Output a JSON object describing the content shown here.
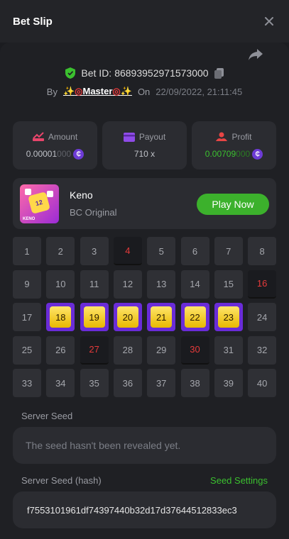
{
  "header": {
    "title": "Bet Slip"
  },
  "bet": {
    "id_label": "Bet ID:",
    "id": "86893952971573000",
    "by_label": "By",
    "user": "Master",
    "on_label": "On",
    "date": "22/09/2022, 21:11:45"
  },
  "stats": {
    "amount": {
      "label": "Amount",
      "value_main": "0.00001",
      "value_dim": "000"
    },
    "payout": {
      "label": "Payout",
      "value": "710 x"
    },
    "profit": {
      "label": "Profit",
      "value_main": "0.00709",
      "value_dim": "000"
    },
    "coin_symbol": "₵"
  },
  "game": {
    "name": "Keno",
    "subtitle": "BC Original",
    "thumb_label": "KENO",
    "play_label": "Play Now"
  },
  "board": {
    "numbers": [
      1,
      2,
      3,
      4,
      5,
      6,
      7,
      8,
      9,
      10,
      11,
      12,
      13,
      14,
      15,
      16,
      17,
      18,
      19,
      20,
      21,
      22,
      23,
      24,
      25,
      26,
      27,
      28,
      29,
      30,
      31,
      32,
      33,
      34,
      35,
      36,
      37,
      38,
      39,
      40
    ],
    "hits": [
      18,
      19,
      20,
      21,
      22,
      23
    ],
    "misses": [
      4,
      16,
      27,
      30
    ]
  },
  "server_seed": {
    "label": "Server Seed",
    "placeholder": "The seed hasn't been revealed yet."
  },
  "server_seed_hash": {
    "label": "Server Seed (hash)",
    "settings_label": "Seed Settings",
    "value": "f7553101961df74397440b32d17d37644512833ec3"
  },
  "colors": {
    "green": "#3cb12c",
    "purple": "#6a2cd8",
    "red": "#e63a3a",
    "gold": "#ffd84a"
  }
}
